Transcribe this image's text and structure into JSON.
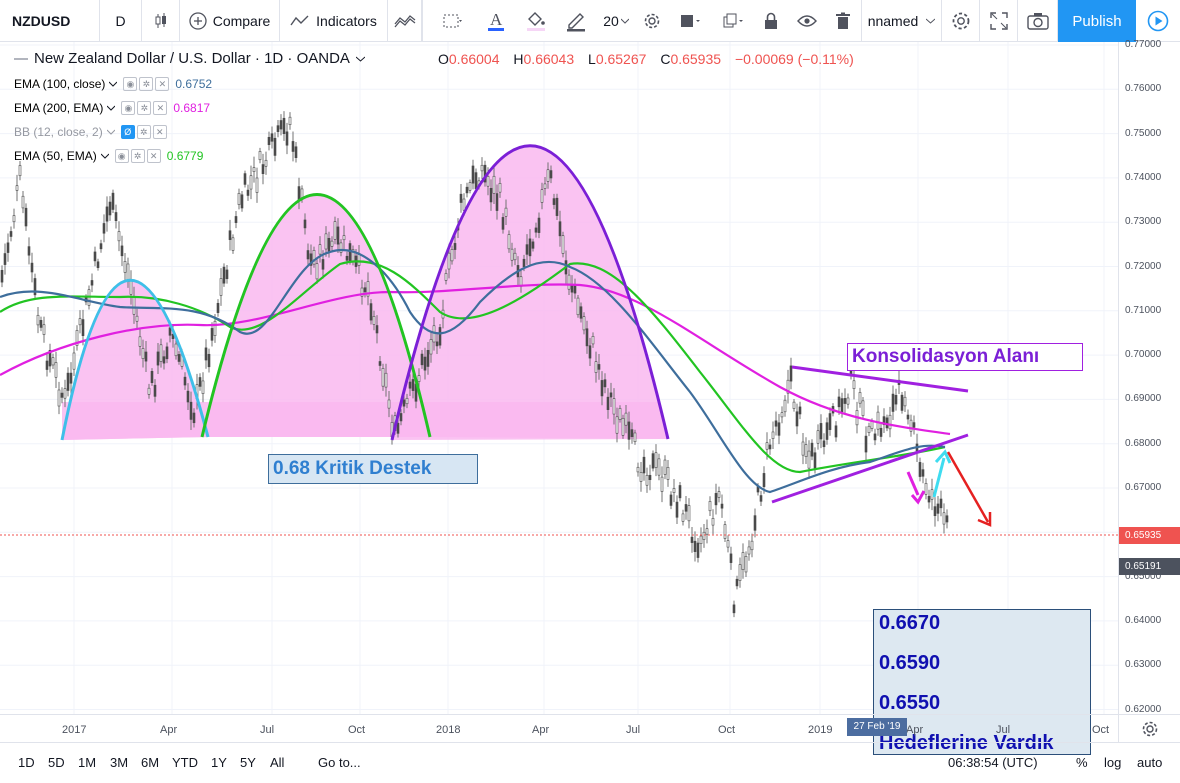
{
  "toolbar": {
    "symbol": "NZDUSD",
    "interval": "D",
    "compare_label": "Compare",
    "indicators_label": "Indicators",
    "font_size": "20",
    "layout_name": "nnamed",
    "publish_label": "Publish"
  },
  "legend": {
    "title": "New Zealand Dollar / U.S. Dollar · 1D · OANDA",
    "ohlc": {
      "o_label": "O",
      "o": "0.66004",
      "h_label": "H",
      "h": "0.66043",
      "l_label": "L",
      "l": "0.65267",
      "c_label": "C",
      "c": "0.65935",
      "change": "−0.00069 (−0.11%)"
    },
    "indicators": [
      {
        "label": "EMA (100, close)",
        "value": "0.6752",
        "color": "#3e6e9c"
      },
      {
        "label": "EMA (200, EMA)",
        "value": "0.6817",
        "color": "#e020e0"
      },
      {
        "label": "BB (12, close, 2)",
        "value": "",
        "color": "#2196f3"
      },
      {
        "label": "EMA (50, EMA)",
        "value": "0.6779",
        "color": "#22c422"
      }
    ]
  },
  "price_axis": {
    "labels": [
      "0.77000",
      "0.76000",
      "0.75000",
      "0.74000",
      "0.73000",
      "0.72000",
      "0.71000",
      "0.70000",
      "0.69000",
      "0.68000",
      "0.67000",
      "0.66000",
      "0.65000",
      "0.64000",
      "0.63000",
      "0.62000"
    ],
    "current_price": "0.65935",
    "current_color": "#ef5350",
    "crosshair_price": "0.65191"
  },
  "time_axis": {
    "labels": [
      "2017",
      "Apr",
      "Jul",
      "Oct",
      "2018",
      "Apr",
      "Jul",
      "Oct",
      "2019",
      "Apr",
      "Jul",
      "Oct"
    ],
    "crosshair_date": "27 Feb '19"
  },
  "annotations": {
    "consolidation": "Konsolidasyon Alanı",
    "support": "0.68 Kritik Destek",
    "targets": [
      "0.6670",
      "0.6590",
      "0.6550",
      "Hedeflerine Vardık"
    ]
  },
  "bottom": {
    "ranges": [
      "1D",
      "5D",
      "1M",
      "3M",
      "6M",
      "YTD",
      "1Y",
      "5Y",
      "All"
    ],
    "goto_label": "Go to...",
    "clock": "06:38:54 (UTC)",
    "percent_label": "%",
    "log_label": "log",
    "auto_label": "auto"
  }
}
